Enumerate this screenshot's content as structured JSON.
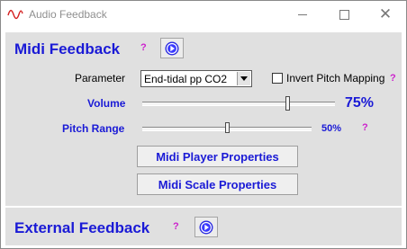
{
  "window": {
    "title": "Audio Feedback"
  },
  "midi_feedback": {
    "title": "Midi Feedback",
    "help": "?",
    "parameter_label": "Parameter",
    "parameter_value": "End-tidal pp CO2",
    "invert_label": "Invert Pitch Mapping",
    "invert_checked": false,
    "invert_help": "?",
    "volume_label": "Volume",
    "volume_value_text": "75%",
    "volume_level": 0.75,
    "pitch_label": "Pitch Range",
    "pitch_value_text": "50%",
    "pitch_level": 0.5,
    "pitch_help": "?",
    "player_button": "Midi Player Properties",
    "scale_button": "Midi Scale Properties"
  },
  "external_feedback": {
    "title": "External Feedback",
    "help": "?"
  },
  "colors": {
    "accent": "#1a1ad6",
    "help": "#cc22cc",
    "panel": "#e0e0e0"
  }
}
